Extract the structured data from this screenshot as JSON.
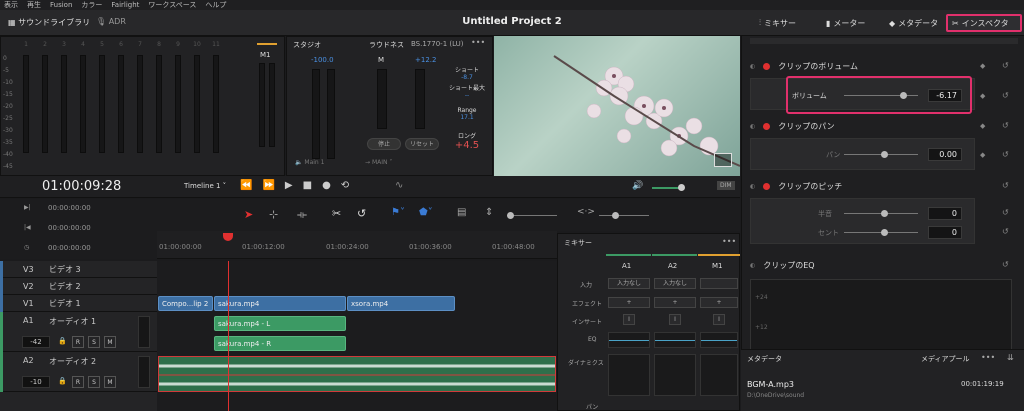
{
  "menu": [
    "表示",
    "再生",
    "Fusion",
    "カラー",
    "Fairlight",
    "ワークスペース",
    "ヘルプ"
  ],
  "topbar": {
    "library": "サウンドライブラリ",
    "adr": "ADR",
    "title": "Untitled Project 2",
    "mixer": "ミキサー",
    "meter": "メーター",
    "metadata": "メタデータ",
    "inspector": "インスペクタ"
  },
  "meters": {
    "channels": [
      "1",
      "2",
      "3",
      "4",
      "5",
      "6",
      "7",
      "8",
      "9",
      "10",
      "11"
    ],
    "scale": [
      "0",
      "-5",
      "-10",
      "-15",
      "-20",
      "-25",
      "-30",
      "-35",
      "-40",
      "-45",
      "-50"
    ],
    "m1": "M1"
  },
  "studio": {
    "label": "スタジオ",
    "value": "-100.0"
  },
  "loudness": {
    "label": "ラウドネス",
    "standard": "BS.1770-1 (LU)",
    "m": "M",
    "plus_value": "+12.2",
    "short_label": "ショート",
    "short_value": "-8.7",
    "short_max_label": "ショート最大",
    "short_max_value": "--",
    "range_label": "Range",
    "range_value": "17.1",
    "long_label": "ロング",
    "long_value": "+4.5",
    "stop": "停止",
    "reset": "リセット",
    "main1": "Main 1",
    "main_out": "MAIN"
  },
  "transport": {
    "timecode": "01:00:09:28",
    "timeline": "Timeline 1",
    "dim": "DIM"
  },
  "tc_rows": [
    "00:00:00:00",
    "00:00:00:00",
    "00:00:00:00"
  ],
  "ruler": [
    "01:00:00:00",
    "01:00:12:00",
    "01:00:24:00",
    "01:00:36:00",
    "01:00:48:00"
  ],
  "tracks": {
    "v3": {
      "id": "V3",
      "name": "ビデオ 3"
    },
    "v2": {
      "id": "V2",
      "name": "ビデオ 2"
    },
    "v1": {
      "id": "V1",
      "name": "ビデオ 1"
    },
    "a1": {
      "id": "A1",
      "name": "オーディオ 1",
      "vol": "-42"
    },
    "a2": {
      "id": "A2",
      "name": "オーディオ 2",
      "vol": "-10"
    }
  },
  "clips": {
    "compo": "Compo...lip 2",
    "sakura": "sakura.mp4",
    "xsora": "xsora.mp4",
    "sakura_l": "sakura.mp4 - L",
    "sakura_r": "sakura.mp4 - R"
  },
  "mixer": {
    "title": "ミキサー",
    "cols": [
      "A1",
      "A2",
      "M1"
    ],
    "input": "入力",
    "input_none": "入力なし",
    "effect": "エフェクト",
    "insert": "インサート",
    "eq": "EQ",
    "dynamics": "ダイナミクス",
    "pan": "パン"
  },
  "inspector": {
    "clip_volume": "クリップのボリューム",
    "volume": "ボリューム",
    "volume_value": "-6.17",
    "clip_pan": "クリップのパン",
    "pan": "パン",
    "pan_value": "0.00",
    "clip_pitch": "クリップのピッチ",
    "semitone": "半音",
    "semitone_value": "0",
    "cent": "セント",
    "cent_value": "0",
    "clip_eq": "クリップのEQ",
    "eq_scale": [
      "+24",
      "+12",
      "0"
    ]
  },
  "metadata_panel": {
    "title": "メタデータ",
    "pool": "メディアプール",
    "file": "BGM-A.mp3",
    "duration": "00:01:19:19",
    "path": "D:\\OneDrive\\sound"
  },
  "colors": {
    "accent": "#e1306c",
    "video_clip": "#3d6fa3",
    "audio_clip": "#3c9a64",
    "playhead": "#e03030"
  }
}
